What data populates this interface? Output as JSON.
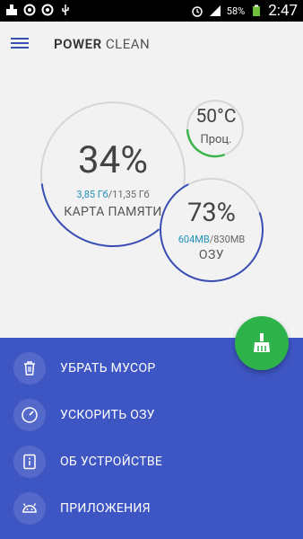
{
  "status_bar": {
    "battery": "58%",
    "time": "2:47",
    "icons": [
      "cleaner-notification-icon",
      "sync-icon",
      "sync-icon",
      "usb-icon",
      "alarm-icon",
      "signal-icon",
      "battery-charging-icon"
    ]
  },
  "app_bar": {
    "title_bold": "POWER",
    "title_light": "CLEAN"
  },
  "memory_card": {
    "percent": "34%",
    "used": "3,85 Гб",
    "total": "/11,35 Гб",
    "label": "КАРТА ПАМЯТИ",
    "fill": 0.34
  },
  "cpu": {
    "temp": "50°C",
    "label": "Проц.",
    "fill": 0.3
  },
  "ram": {
    "percent": "73%",
    "used": "604MB",
    "total": "/830MB",
    "label": "ОЗУ",
    "fill": 0.73
  },
  "menu": {
    "items": [
      {
        "label": "УБРАТЬ МУСОР",
        "icon": "trash-icon"
      },
      {
        "label": "УСКОРИТЬ ОЗУ",
        "icon": "speedometer-icon"
      },
      {
        "label": "ОБ УСТРОЙСТВЕ",
        "icon": "info-icon"
      },
      {
        "label": "ПРИЛОЖЕНИЯ",
        "icon": "android-icon"
      }
    ]
  },
  "colors": {
    "accent_blue": "#3e55c4",
    "gauge_blue": "#3a4fb5",
    "cpu_green": "#3bb54a",
    "fab_green": "#2eb34a",
    "value_teal": "#1f8fb8"
  }
}
